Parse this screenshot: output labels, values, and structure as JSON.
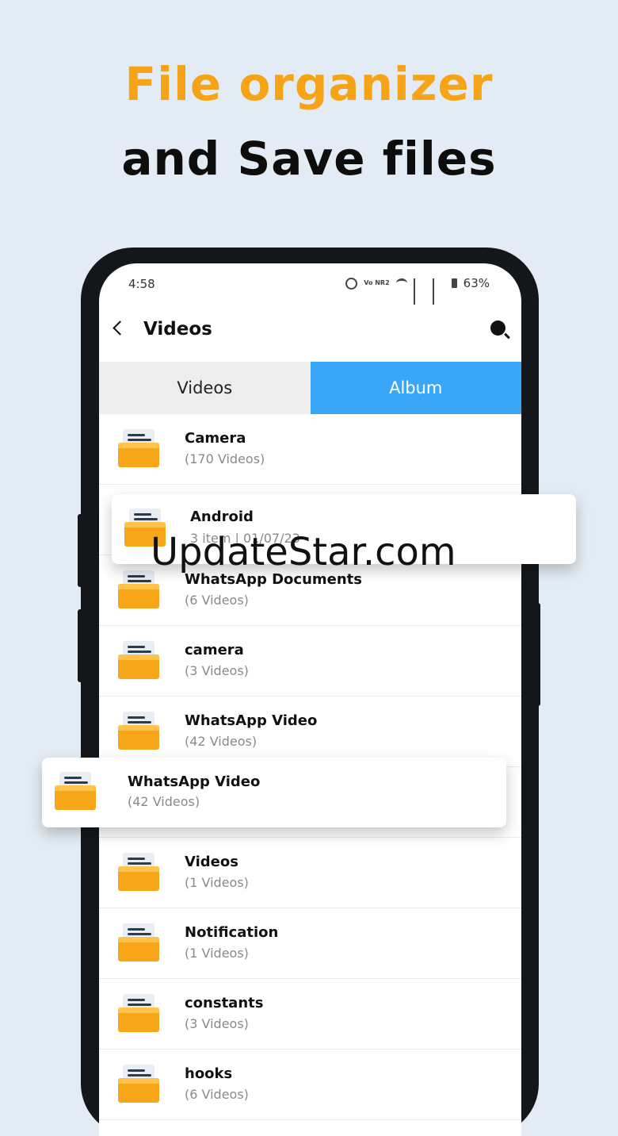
{
  "promo": {
    "line1": "File organizer",
    "line2": "and Save files"
  },
  "statusbar": {
    "time": "4:58",
    "volte": "Vo NR2",
    "battery": "63%"
  },
  "toolbar": {
    "title": "Videos"
  },
  "tabs": [
    {
      "label": "Videos",
      "active": false
    },
    {
      "label": "Album",
      "active": true
    }
  ],
  "albums": [
    {
      "name": "Camera",
      "count": "(170 Videos)"
    },
    {
      "name": "",
      "count": ""
    },
    {
      "name": "WhatsApp Documents",
      "count": "(6 Videos)"
    },
    {
      "name": "camera",
      "count": "(3 Videos)"
    },
    {
      "name": "WhatsApp Video",
      "count": "(42 Videos)"
    },
    {
      "name": "",
      "count": ""
    },
    {
      "name": "Videos",
      "count": "(1 Videos)"
    },
    {
      "name": "Notification",
      "count": "(1 Videos)"
    },
    {
      "name": "constants",
      "count": "(3 Videos)"
    },
    {
      "name": "hooks",
      "count": "(6 Videos)"
    }
  ],
  "floating_cards": [
    {
      "name": "Android",
      "meta": "3 item | 01/07/23"
    },
    {
      "name": "WhatsApp Video",
      "count": "(42 Videos)"
    }
  ],
  "watermark": "UpdateStar.com",
  "colors": {
    "accent_orange": "#f7a318",
    "tab_active": "#3aa6f8",
    "folder": "#f8a619"
  }
}
